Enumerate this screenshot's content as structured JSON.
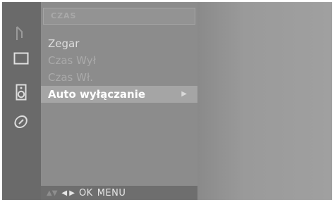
{
  "menu": {
    "title": "CZAS",
    "items": [
      {
        "label": "Zegar",
        "state": "enabled"
      },
      {
        "label": "Czas Wył",
        "state": "disabled"
      },
      {
        "label": "Czas Wł.",
        "state": "disabled"
      },
      {
        "label": "Auto wyłączanie",
        "state": "selected",
        "arrow": "▶"
      }
    ]
  },
  "sidebar": {
    "icons": [
      "input-icon",
      "picture-icon",
      "audio-icon",
      "time-icon"
    ]
  },
  "footer": {
    "up_down": "▲▼",
    "left_right": "◀ ▶",
    "ok_label": "OK",
    "menu_label": "MENU"
  },
  "colors": {
    "screen_bg": "#7d7d7d",
    "highlight": "#a5a5a5"
  }
}
